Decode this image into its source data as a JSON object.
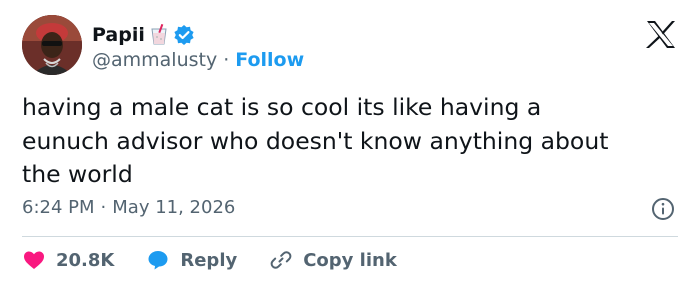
{
  "author": {
    "display_name": "Papii",
    "handle": "@ammalusty",
    "separator": "·",
    "follow_label": "Follow"
  },
  "tweet": {
    "text": "having a male cat is so cool its like having a\neunuch advisor who doesn't know anything about\nthe world",
    "time": "6:24 PM",
    "meta_separator": "·",
    "date": "May 11, 2026"
  },
  "actions": {
    "likes_count": "20.8K",
    "reply_label": "Reply",
    "copy_link_label": "Copy link"
  },
  "colors": {
    "accent": "#1d9bf0",
    "like": "#f91880",
    "text": "#0f1419",
    "muted": "#536471",
    "divider": "#cfd9de"
  },
  "icons": {
    "verified": "verified-badge-icon",
    "logo": "x-logo-icon",
    "info": "info-icon",
    "like": "heart-icon",
    "reply": "speech-bubble-icon",
    "copy_link": "link-icon",
    "emoji": "milk-glass-emoji-icon"
  }
}
